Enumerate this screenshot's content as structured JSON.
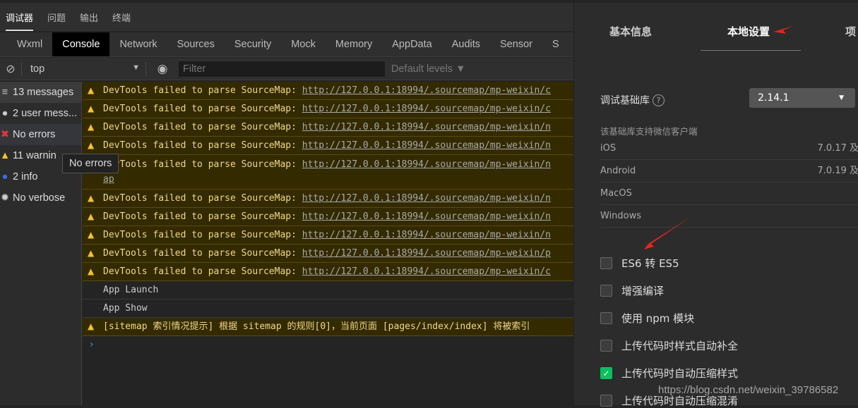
{
  "panel_tabs": [
    "调试器",
    "问题",
    "输出",
    "终端"
  ],
  "devtools_tabs": [
    "Wxml",
    "Console",
    "Network",
    "Sources",
    "Security",
    "Mock",
    "Memory",
    "AppData",
    "Audits",
    "Sensor",
    "S"
  ],
  "toolbar": {
    "context": "top",
    "filter_placeholder": "Filter",
    "levels": "Default levels ▼"
  },
  "sidebar": [
    {
      "icon": "list-icon",
      "label": "13 messages"
    },
    {
      "icon": "user-icon",
      "label": "2 user mess..."
    },
    {
      "icon": "error-icon",
      "label": "No errors"
    },
    {
      "icon": "warning-icon",
      "label": "11 warnin"
    },
    {
      "icon": "info-icon",
      "label": "2 info"
    },
    {
      "icon": "verbose-icon",
      "label": "No verbose"
    }
  ],
  "tooltip": "No errors",
  "messages": [
    {
      "type": "warn",
      "text": "DevTools failed to parse SourceMap: ",
      "link": "http://127.0.0.1:18994/.sourcemap/mp-weixin/c"
    },
    {
      "type": "warn",
      "text": "DevTools failed to parse SourceMap: ",
      "link": "http://127.0.0.1:18994/.sourcemap/mp-weixin/c"
    },
    {
      "type": "warn",
      "text": "DevTools failed to parse SourceMap: ",
      "link": "http://127.0.0.1:18994/.sourcemap/mp-weixin/n"
    },
    {
      "type": "warn",
      "text": "DevTools failed to parse SourceMap: ",
      "link": "http://127.0.0.1:18994/.sourcemap/mp-weixin/n"
    },
    {
      "type": "warn",
      "text": "DevTools failed to parse SourceMap: ",
      "link": "http://127.0.0.1:18994/.sourcemap/mp-weixin/n",
      "link2": "ap"
    },
    {
      "type": "warn",
      "text": "DevTools failed to parse SourceMap: ",
      "link": "http://127.0.0.1:18994/.sourcemap/mp-weixin/n"
    },
    {
      "type": "warn",
      "text": "DevTools failed to parse SourceMap: ",
      "link": "http://127.0.0.1:18994/.sourcemap/mp-weixin/n"
    },
    {
      "type": "warn",
      "text": "DevTools failed to parse SourceMap: ",
      "link": "http://127.0.0.1:18994/.sourcemap/mp-weixin/n"
    },
    {
      "type": "warn",
      "text": "DevTools failed to parse SourceMap: ",
      "link": "http://127.0.0.1:18994/.sourcemap/mp-weixin/p"
    },
    {
      "type": "warn",
      "text": "DevTools failed to parse SourceMap: ",
      "link": "http://127.0.0.1:18994/.sourcemap/mp-weixin/c"
    },
    {
      "type": "info",
      "text": "App Launch"
    },
    {
      "type": "info",
      "text": "App Show"
    },
    {
      "type": "warn",
      "text": "[sitemap 索引情况提示] 根据 sitemap 的规则[0]，当前页面 [pages/index/index] 将被索引"
    }
  ],
  "prompt": "›",
  "settings": {
    "tabs": [
      "基本信息",
      "本地设置",
      "项"
    ],
    "lib_label": "调试基础库",
    "lib_value": "2.14.1",
    "support_label": "该基础库支持微信客户端",
    "platforms": [
      {
        "name": "iOS",
        "version": "7.0.17 及"
      },
      {
        "name": "Android",
        "version": "7.0.19 及"
      },
      {
        "name": "MacOS",
        "version": ""
      },
      {
        "name": "Windows",
        "version": ""
      }
    ],
    "options": [
      {
        "label": "ES6 转 ES5",
        "checked": false
      },
      {
        "label": "增强编译",
        "checked": false
      },
      {
        "label": "使用 npm 模块",
        "checked": false
      },
      {
        "label": "上传代码时样式自动补全",
        "checked": false
      },
      {
        "label": "上传代码时自动压缩样式",
        "checked": true
      },
      {
        "label": "上传代码时自动压缩混淆",
        "checked": false
      }
    ]
  },
  "watermark": "https://blog.csdn.net/weixin_39786582",
  "colors": {
    "accent_green": "#07c160",
    "warning_bg": "#332a00",
    "arrow_red": "#e8231b"
  }
}
